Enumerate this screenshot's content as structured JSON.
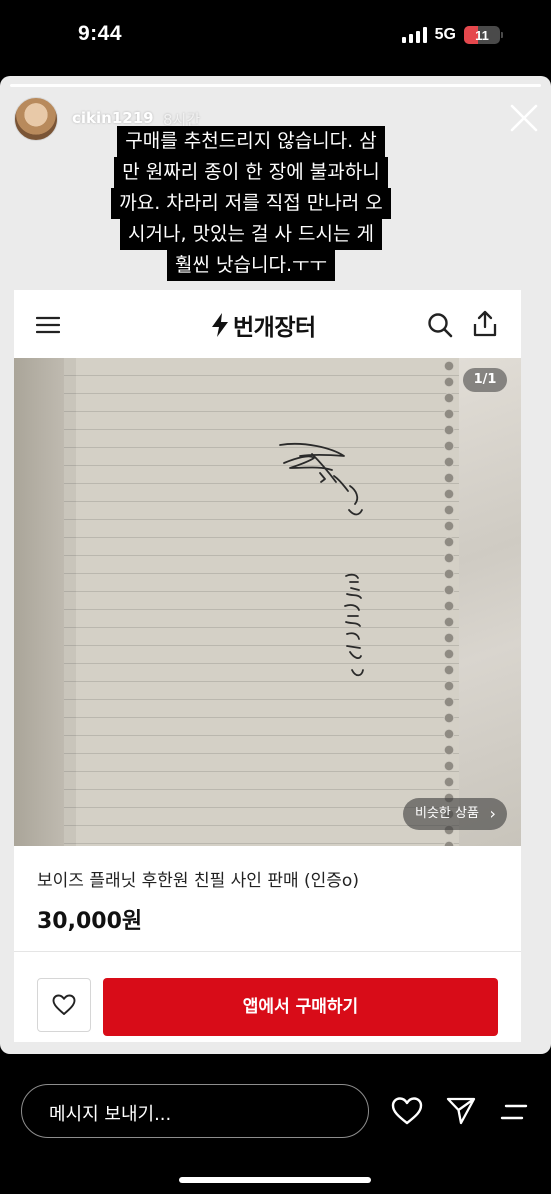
{
  "status_bar": {
    "time": "9:44",
    "network": "5G",
    "battery": "11"
  },
  "story": {
    "username": "cikin1219",
    "time_ago": "8시간",
    "caption_lines": [
      "구매를 추천드리지 않습니다. 삼",
      "만 원짜리 종이 한 장에 불과하니",
      "까요. 차라리 저를 직접 만나러 오",
      "시거나, 맛있는 걸 사 드시는 게",
      "훨씬 낫습니다.ㅜㅜ"
    ]
  },
  "app": {
    "brand": "번개장터",
    "image_counter": "1/1",
    "similar_label": "비슷한 상품",
    "product_title": "보이즈 플래닛 후한원 친필 사인 판매 (인증o)",
    "price": "30,000원",
    "buy_label": "앱에서 구매하기",
    "accent": "#d80c18"
  },
  "bottom_bar": {
    "message_placeholder": "메시지 보내기..."
  }
}
